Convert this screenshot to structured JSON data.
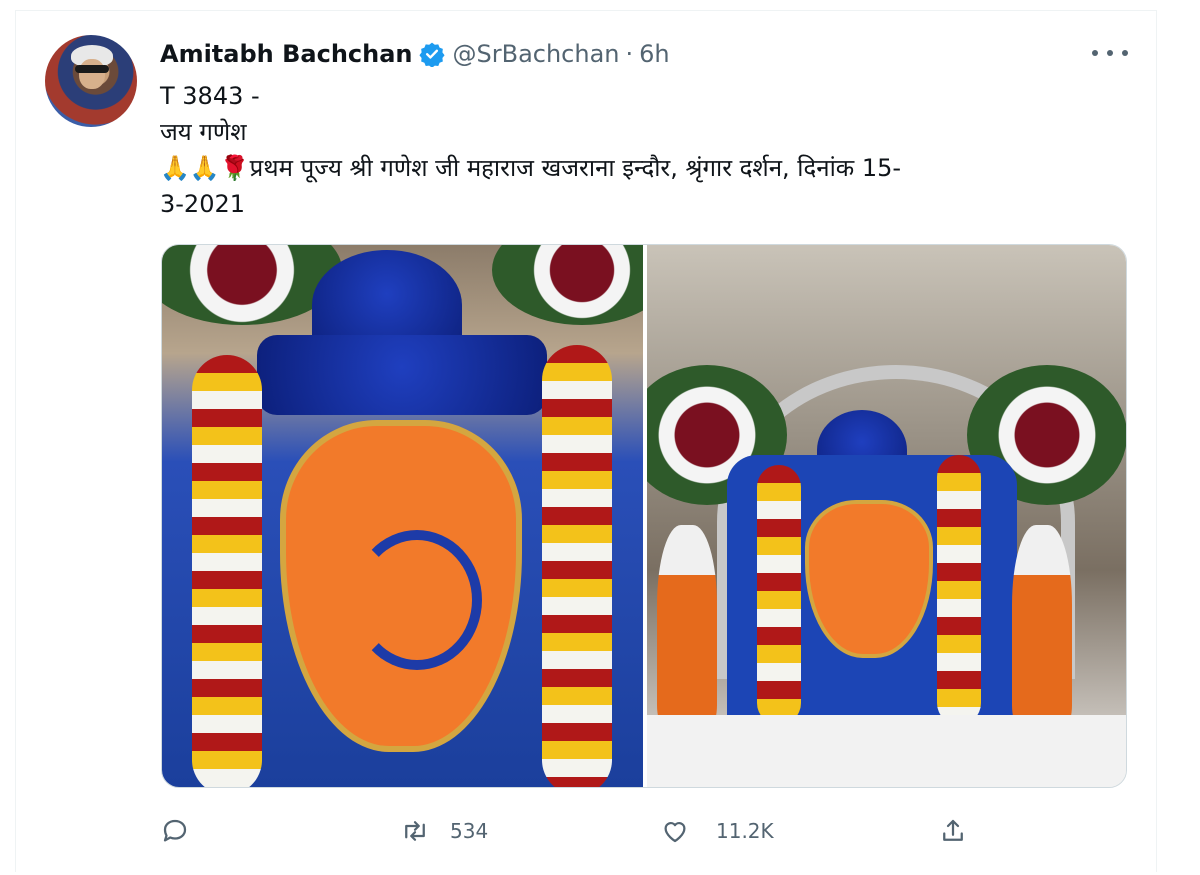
{
  "tweet": {
    "author_name": "Amitabh Bachchan",
    "handle": "@SrBachchan",
    "separator": "·",
    "time": "6h",
    "lines": [
      "T 3843 -",
      "जय गणेश",
      "🙏🙏🌹प्रथम पूज्य श्री गणेश जी महाराज खजराना इन्दौर,  श्रृंगार दर्शन, दिनांक 15-",
      "3-2021"
    ]
  },
  "actions": {
    "reply_count": "",
    "retweet_count": "534",
    "like_count": "11.2K"
  },
  "icons": {
    "verified": "verified-badge-icon",
    "more": "more-icon",
    "reply": "reply-icon",
    "retweet": "retweet-icon",
    "like": "like-icon",
    "share": "share-icon"
  },
  "colors": {
    "verified_blue": "#1d9bf0",
    "secondary_text": "#536471"
  }
}
